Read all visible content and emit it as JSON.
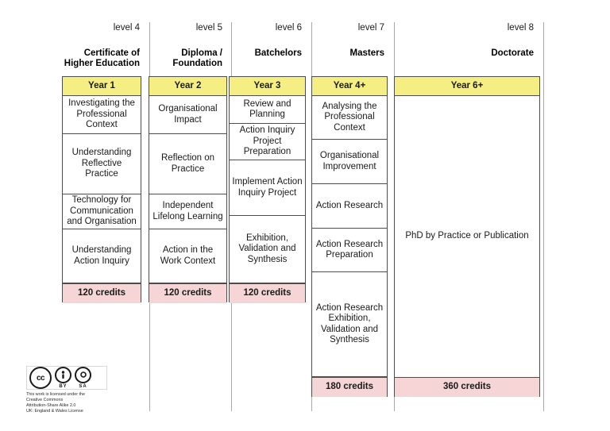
{
  "diagram": {
    "title": "Work Based Learning Framework Levels",
    "colors": {
      "year_band": "#F5EE82",
      "credits_band": "#F5D5D5",
      "box_border": "#4D4D4D",
      "divider": "#A8A8A8"
    },
    "columns": [
      {
        "level": "level 4",
        "award": "Certificate of\nHigher Education",
        "award_lines": [
          "Certificate of",
          "Higher Education"
        ],
        "year": "Year 1",
        "modules": [
          "Investigating the Professional Context",
          "Understanding Reflective Practice",
          "Technology for Communication and Organisation",
          "Understanding Action Inquiry"
        ],
        "credits": "120 credits"
      },
      {
        "level": "level 5",
        "award": "Diploma /\nFoundation",
        "award_lines": [
          "Diploma /",
          "Foundation"
        ],
        "year": "Year 2",
        "modules": [
          "Organisational Impact",
          "Reflection on Practice",
          "Independent Lifelong Learning",
          "Action in the Work Context"
        ],
        "credits": "120 credits"
      },
      {
        "level": "level 6",
        "award": "Batchelors",
        "award_lines": [
          "Batchelors"
        ],
        "year": "Year 3",
        "modules": [
          "Review and Planning",
          "Action Inquiry Project Preparation",
          "Implement Action Inquiry Project",
          "Exhibition, Validation and Synthesis"
        ],
        "credits": "120 credits"
      },
      {
        "level": "level 7",
        "award": "Masters",
        "award_lines": [
          "Masters"
        ],
        "year": "Year 4+",
        "modules": [
          "Analysing the Professional Context",
          "Organisational Improvement",
          "Action Research",
          "Action Research Preparation",
          "Action Research Exhibition, Validation and Synthesis"
        ],
        "credits": "180 credits"
      },
      {
        "level": "level 8",
        "award": "Doctorate",
        "award_lines": [
          "Doctorate"
        ],
        "year": "Year 6+",
        "modules": [
          "PhD by Practice or Publication"
        ],
        "credits": "360 credits"
      }
    ]
  },
  "license": {
    "badge": {
      "main": "cc",
      "by_glyph": "i",
      "sa_glyph": "ⓞ",
      "by_label": "BY",
      "sa_label": "SA"
    },
    "lines": [
      "This work is licensed under the",
      "Creative Commons",
      "Attribution-Share Alike 2.0",
      "UK: England & Wales License"
    ]
  }
}
